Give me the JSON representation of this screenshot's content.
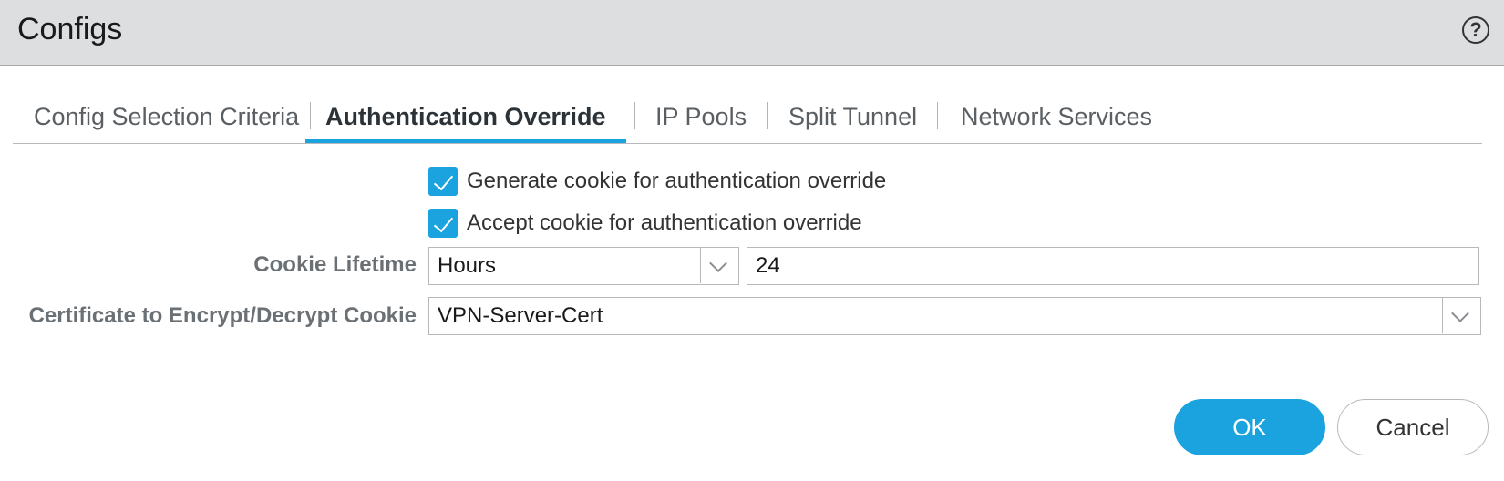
{
  "dialog": {
    "title": "Configs",
    "help_icon_glyph": "?"
  },
  "tabs": [
    {
      "label": "Config Selection Criteria",
      "active": false
    },
    {
      "label": "Authentication Override",
      "active": true
    },
    {
      "label": "IP Pools",
      "active": false
    },
    {
      "label": "Split Tunnel",
      "active": false
    },
    {
      "label": "Network Services",
      "active": false
    }
  ],
  "form": {
    "generate_cookie": {
      "label": "Generate cookie for authentication override",
      "checked": true
    },
    "accept_cookie": {
      "label": "Accept cookie for authentication override",
      "checked": true
    },
    "cookie_lifetime": {
      "label": "Cookie Lifetime",
      "unit_selected": "Hours",
      "value": "24"
    },
    "certificate": {
      "label": "Certificate to Encrypt/Decrypt Cookie",
      "selected": "VPN-Server-Cert"
    }
  },
  "buttons": {
    "ok": "OK",
    "cancel": "Cancel"
  },
  "colors": {
    "accent": "#1ba3e0",
    "titlebar": "#dcdee0"
  },
  "icons": {
    "help": "help-icon",
    "checkbox_check": "check-icon",
    "dropdown": "chevron-down-icon"
  }
}
